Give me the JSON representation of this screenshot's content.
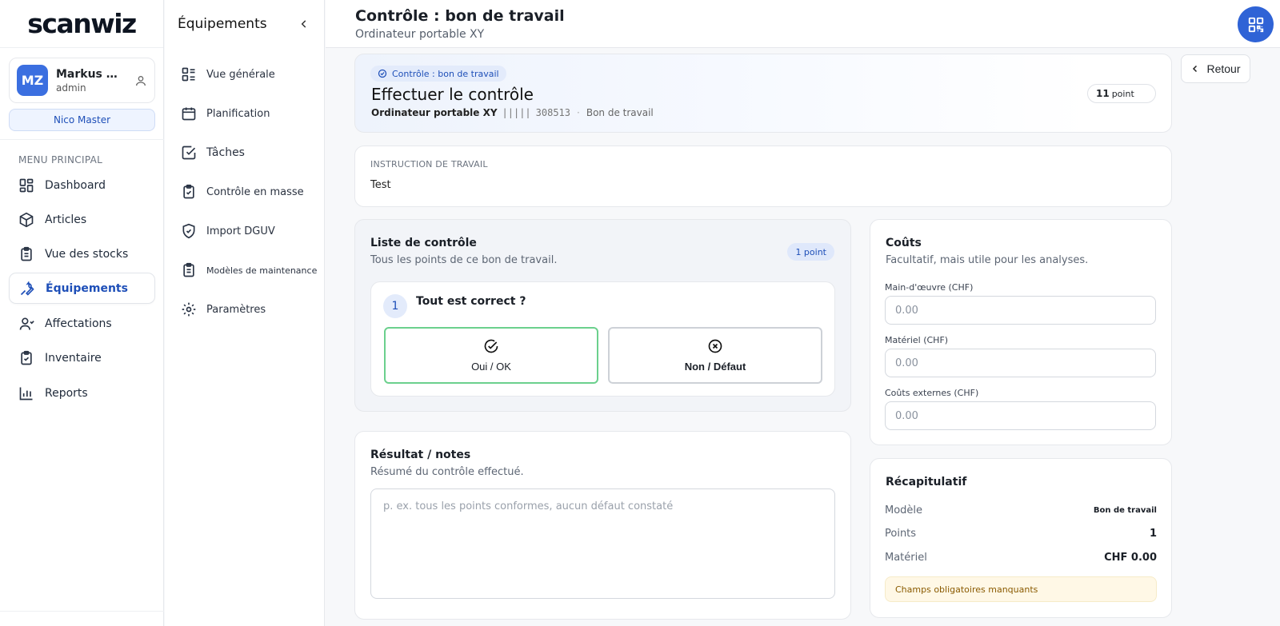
{
  "app": {
    "logo": "scanwiz"
  },
  "user": {
    "initials": "MZ",
    "name": "Markus Zau...",
    "role": "admin",
    "tenant": "Nico Master"
  },
  "nav": {
    "heading": "MENU PRINCIPAL",
    "items": [
      {
        "label": "Dashboard",
        "icon": "dashboard-icon"
      },
      {
        "label": "Articles",
        "icon": "box-icon"
      },
      {
        "label": "Vue des stocks",
        "icon": "clipboard-icon"
      },
      {
        "label": "Équipements",
        "icon": "wrench-icon",
        "active": true
      },
      {
        "label": "Affectations",
        "icon": "user-icon"
      },
      {
        "label": "Inventaire",
        "icon": "clipboard-check-icon"
      },
      {
        "label": "Reports",
        "icon": "bar-chart-icon"
      }
    ]
  },
  "subnav": {
    "title": "Équipements",
    "items": [
      {
        "label": "Vue générale",
        "icon": "layout-list-icon"
      },
      {
        "label": "Planification",
        "icon": "calendar-icon"
      },
      {
        "label": "Tâches",
        "icon": "checkbox-icon"
      },
      {
        "label": "Contrôle en masse",
        "icon": "clipboard-check-icon"
      },
      {
        "label": "Import DGUV",
        "icon": "shield-check-icon"
      },
      {
        "label": "Modèles de maintenance",
        "icon": "clipboard-list-icon"
      },
      {
        "label": "Paramètres",
        "icon": "gear-icon"
      }
    ]
  },
  "header": {
    "title": "Contrôle : bon de travail",
    "subtitle": "Ordinateur portable XY",
    "back_label": "Retour"
  },
  "hero": {
    "pill": "Contrôle : bon de travail",
    "title": "Effectuer le contrôle",
    "device": "Ordinateur portable XY",
    "barcode": "308513",
    "type": "Bon de travail",
    "count_value": "11",
    "count_label": "point"
  },
  "instruction": {
    "label": "INSTRUCTION DE TRAVAIL",
    "text": "Test"
  },
  "checklist": {
    "title": "Liste de contrôle",
    "subtitle": "Tous les points de ce bon de travail.",
    "badge": "1 point",
    "question": {
      "number": "1",
      "text": "Tout est correct ?",
      "yes_label": "Oui / OK",
      "no_label": "Non / Défaut"
    }
  },
  "costs": {
    "title": "Coûts",
    "subtitle": "Facultatif, mais utile pour les analyses.",
    "labor_label": "Main-d'œuvre (CHF)",
    "labor_placeholder": "0.00",
    "material_label": "Matériel (CHF)",
    "material_placeholder": "0.00",
    "external_label": "Coûts externes (CHF)",
    "external_placeholder": "0.00"
  },
  "result": {
    "title": "Résultat / notes",
    "subtitle": "Résumé du contrôle effectué.",
    "placeholder": "p. ex. tous les points conformes, aucun défaut constaté"
  },
  "summary": {
    "title": "Récapitulatif",
    "model_label": "Modèle",
    "model_value": "Bon de travail",
    "points_label": "Points",
    "points_value": "1",
    "material_label": "Matériel",
    "material_value": "CHF 0.00",
    "warning": "Champs obligatoires manquants"
  },
  "colors": {
    "primary": "#2f63d6",
    "success": "#6bd08d",
    "warning_bg": "#fff8e6"
  }
}
